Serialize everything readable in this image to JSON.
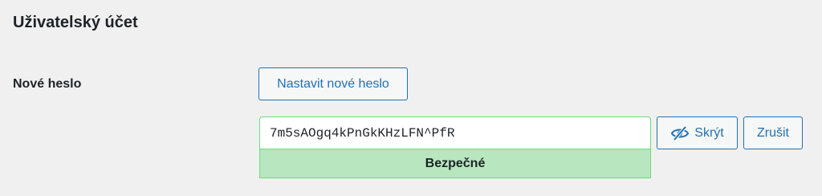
{
  "section": {
    "title": "Uživatelský účet"
  },
  "password": {
    "label": "Nové heslo",
    "generate_label": "Nastavit nové heslo",
    "value": "7m5sAOgq4kPnGkKHzLFN^PfR",
    "strength": "Bezpečné",
    "hide_label": "Skrýt",
    "cancel_label": "Zrušit",
    "hide_icon": "eye-slash-icon"
  },
  "colors": {
    "accent": "#2271b1",
    "strength_bg": "#b8e6bf",
    "strength_border": "#68de7c",
    "page_bg": "#f0f0f1"
  }
}
